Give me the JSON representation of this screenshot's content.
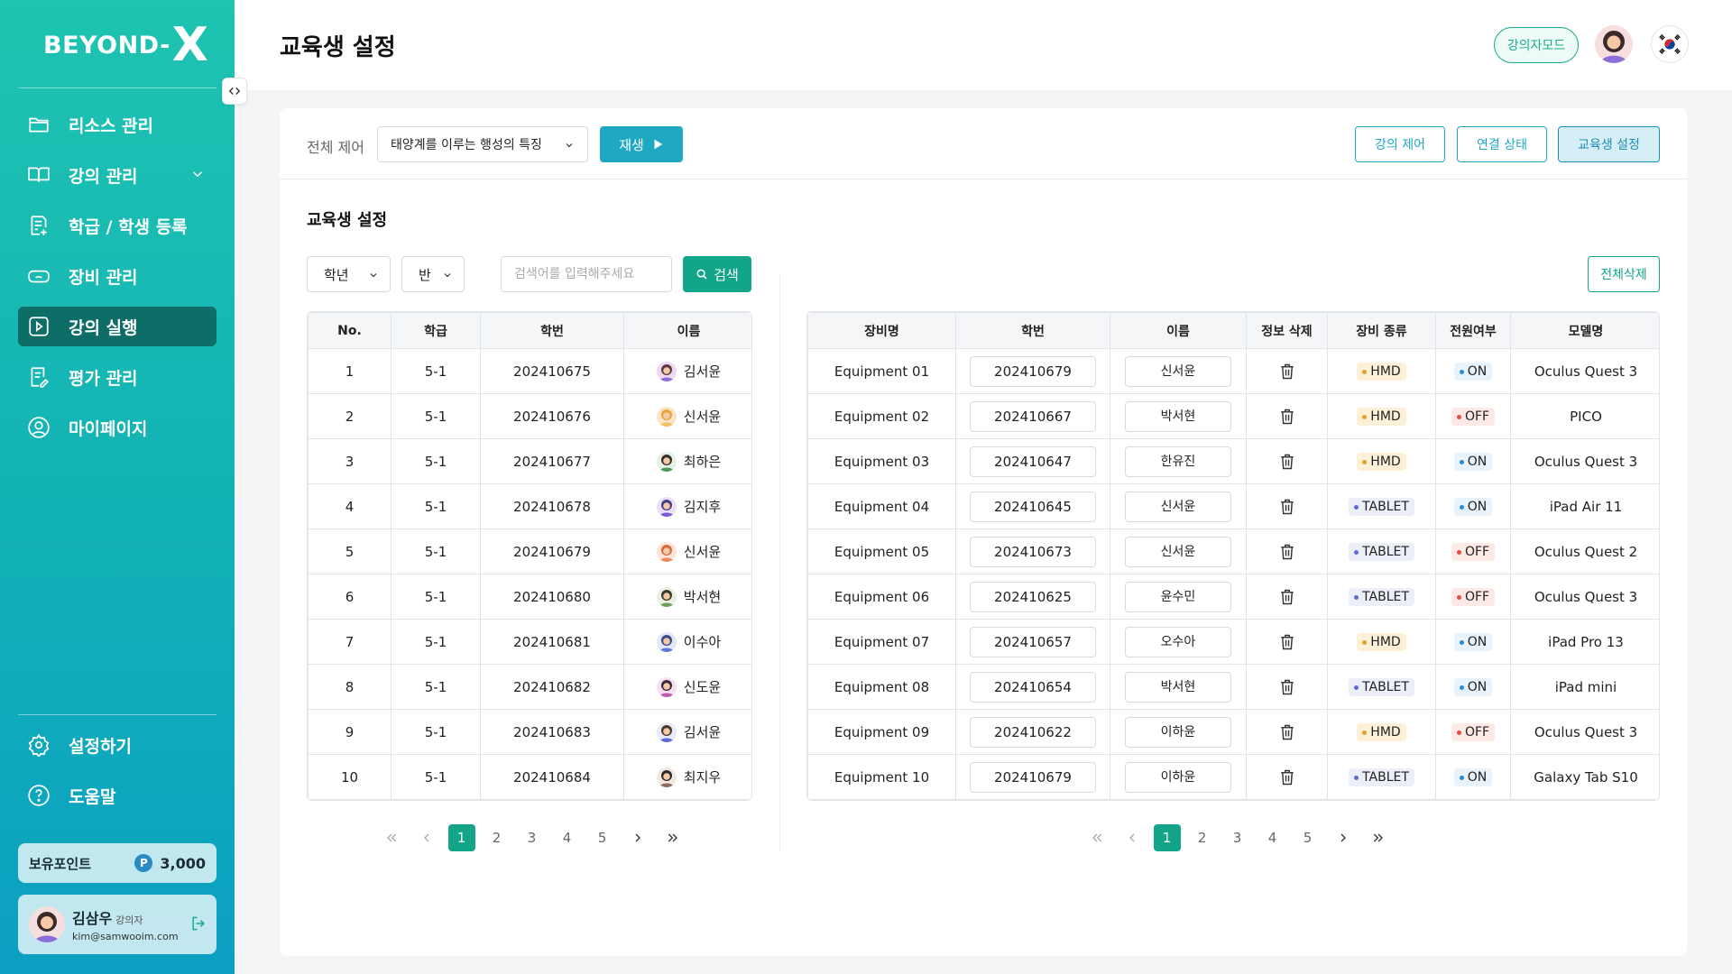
{
  "brand": {
    "logo_text": "BEYOND-",
    "logo_x": "X"
  },
  "sidebar": {
    "items": [
      {
        "label": "리소스 관리",
        "icon": "folder-icon"
      },
      {
        "label": "강의 관리",
        "icon": "book-icon"
      },
      {
        "label": "학급 / 학생 등록",
        "icon": "register-icon"
      },
      {
        "label": "장비 관리",
        "icon": "vr-headset-icon"
      },
      {
        "label": "강의 실행",
        "icon": "play-square-icon"
      },
      {
        "label": "평가 관리",
        "icon": "evaluation-icon"
      },
      {
        "label": "마이페이지",
        "icon": "user-circle-icon"
      }
    ],
    "bottom_items": [
      {
        "label": "설정하기",
        "icon": "gear-icon"
      },
      {
        "label": "도움말",
        "icon": "help-icon"
      }
    ],
    "points_label": "보유포인트",
    "points_badge": "P",
    "points_value": "3,000",
    "user": {
      "name": "김삼우",
      "role": "강의자",
      "email": "kim@samwooim.com"
    }
  },
  "header": {
    "title": "교육생 설정",
    "mode_button": "강의자모드"
  },
  "control": {
    "label": "전체 제어",
    "lecture_selected": "태양계를 이루는 행성의 특징",
    "play_label": "재생",
    "tabs": [
      "강의 제어",
      "연결 상태",
      "교육생 설정"
    ]
  },
  "section": {
    "title": "교육생 설정",
    "grade_filter": "학년",
    "class_filter": "반",
    "search_placeholder": "검색어를 입력해주세요",
    "search_label": "검색",
    "delete_all": "전체삭제"
  },
  "students": {
    "headers": [
      "No.",
      "학급",
      "학번",
      "이름"
    ],
    "rows": [
      [
        "1",
        "5-1",
        "202410675",
        "김서윤"
      ],
      [
        "2",
        "5-1",
        "202410676",
        "신서윤"
      ],
      [
        "3",
        "5-1",
        "202410677",
        "최하은"
      ],
      [
        "4",
        "5-1",
        "202410678",
        "김지후"
      ],
      [
        "5",
        "5-1",
        "202410679",
        "신서윤"
      ],
      [
        "6",
        "5-1",
        "202410680",
        "박서현"
      ],
      [
        "7",
        "5-1",
        "202410681",
        "이수아"
      ],
      [
        "8",
        "5-1",
        "202410682",
        "신도윤"
      ],
      [
        "9",
        "5-1",
        "202410683",
        "김서윤"
      ],
      [
        "10",
        "5-1",
        "202410684",
        "최지우"
      ]
    ]
  },
  "equipment": {
    "headers": [
      "장비명",
      "학번",
      "이름",
      "정보 삭제",
      "장비 종류",
      "전원여부",
      "모델명"
    ],
    "rows": [
      [
        "Equipment 01",
        "202410679",
        "신서윤",
        "HMD",
        "ON",
        "Oculus Quest 3"
      ],
      [
        "Equipment 02",
        "202410667",
        "박서현",
        "HMD",
        "OFF",
        "PICO"
      ],
      [
        "Equipment 03",
        "202410647",
        "한유진",
        "HMD",
        "ON",
        "Oculus Quest 3"
      ],
      [
        "Equipment 04",
        "202410645",
        "신서윤",
        "TABLET",
        "ON",
        "iPad Air 11"
      ],
      [
        "Equipment 05",
        "202410673",
        "신서윤",
        "TABLET",
        "OFF",
        "Oculus Quest 2"
      ],
      [
        "Equipment 06",
        "202410625",
        "윤수민",
        "TABLET",
        "OFF",
        "Oculus Quest 3"
      ],
      [
        "Equipment 07",
        "202410657",
        "오수아",
        "HMD",
        "ON",
        "iPad Pro 13"
      ],
      [
        "Equipment 08",
        "202410654",
        "박서현",
        "TABLET",
        "ON",
        "iPad mini"
      ],
      [
        "Equipment 09",
        "202410622",
        "이하윤",
        "HMD",
        "OFF",
        "Oculus Quest 3"
      ],
      [
        "Equipment 10",
        "202410679",
        "이하윤",
        "TABLET",
        "ON",
        "Galaxy Tab S10"
      ]
    ]
  },
  "pagination": {
    "pages": [
      "1",
      "2",
      "3",
      "4",
      "5"
    ],
    "current": "1"
  },
  "colors": {
    "accent": "#13a58a",
    "blue": "#20a7c3",
    "sidebar_active": "#0e6d66"
  }
}
